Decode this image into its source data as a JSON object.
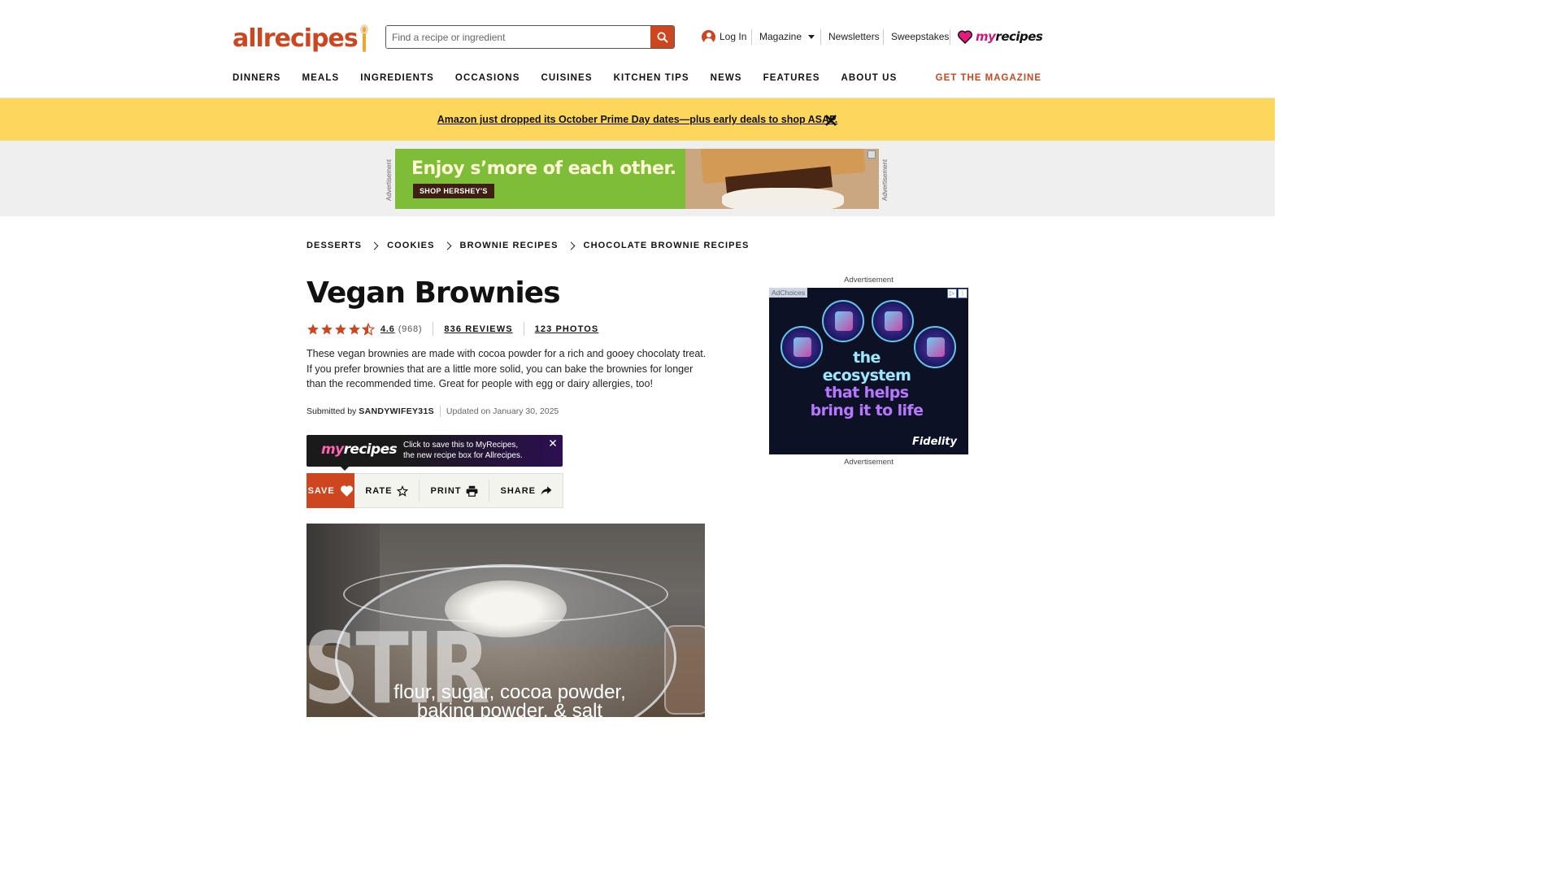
{
  "header": {
    "logo_text": "allrecipes",
    "search": {
      "placeholder": "Find a recipe or ingredient"
    },
    "login_label": "Log In",
    "magazine_label": "Magazine",
    "newsletters_label": "Newsletters",
    "sweepstakes_label": "Sweepstakes",
    "myrecipes": {
      "my": "my",
      "recipes": "recipes"
    },
    "nav": [
      "DINNERS",
      "MEALS",
      "INGREDIENTS",
      "OCCASIONS",
      "CUISINES",
      "KITCHEN TIPS",
      "NEWS",
      "FEATURES",
      "ABOUT US"
    ],
    "get_magazine": "GET THE MAGAZINE",
    "brand_color": "#ce4620"
  },
  "banner": {
    "text": "Amazon just dropped its October Prime Day dates—plus early deals to shop ASAP.",
    "bg_color": "#fdd75c"
  },
  "top_ad": {
    "side_label": "Advertisement",
    "headline": "Enjoy s’more of each other.",
    "button": "SHOP HERSHEY'S"
  },
  "breadcrumbs": [
    "DESSERTS",
    "COOKIES",
    "BROWNIE RECIPES",
    "CHOCOLATE BROWNIE RECIPES"
  ],
  "recipe": {
    "title": "Vegan Brownies",
    "rating": "4.6",
    "rating_value": 4.6,
    "rating_count": "(968)",
    "reviews": "836 REVIEWS",
    "photos": "123 PHOTOS",
    "description": "These vegan brownies are made with cocoa powder for a rich and gooey chocolaty treat. If you prefer brownies that are a little more solid, you can bake the brownies for longer than the recommended time. Great for people with egg or dairy allergies, too!",
    "submitted_by_label": "Submitted by",
    "author": "SANDYWIFEY31S",
    "updated": "Updated on January 30, 2025"
  },
  "promo": {
    "logo_my": "my",
    "logo_recipes": "recipes",
    "line1": "Click to save this to MyRecipes,",
    "line2": "the new recipe box for Allrecipes."
  },
  "actions": {
    "save": "SAVE",
    "rate": "RATE",
    "print": "PRINT",
    "share": "SHARE"
  },
  "main_image": {
    "overlay_word": "STIR",
    "caption": "flour, sugar, cocoa powder, baking powder, & salt"
  },
  "right_ad": {
    "label_top": "Advertisement",
    "label_bottom": "Advertisement",
    "adchoices": "AdChoices",
    "line1": "the",
    "line2": "ecosystem",
    "line3": "that helps",
    "line4": "bring it to life",
    "brand": "Fidelity"
  }
}
